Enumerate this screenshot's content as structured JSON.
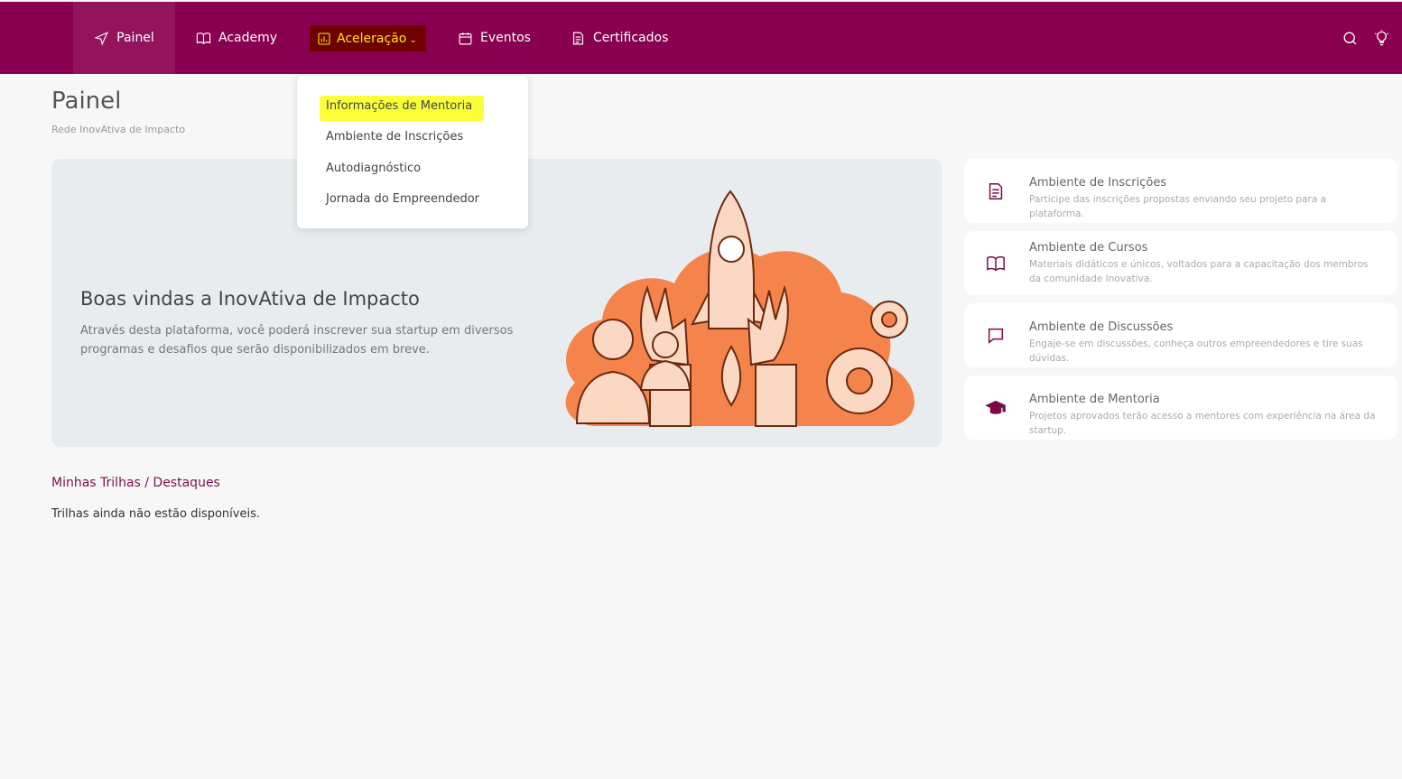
{
  "nav": {
    "items": [
      {
        "label": "Painel",
        "icon": "send-icon"
      },
      {
        "label": "Academy",
        "icon": "book-icon"
      },
      {
        "label": "Aceleração",
        "icon": "chart-icon",
        "active": true
      },
      {
        "label": "Eventos",
        "icon": "calendar-icon"
      },
      {
        "label": "Certificados",
        "icon": "document-icon"
      }
    ],
    "right_icons": [
      "search-icon",
      "lightbulb-icon"
    ]
  },
  "dropdown": {
    "items": [
      "Informações de Mentoria",
      "Ambiente de Inscrições",
      "Autodiagnóstico",
      "Jornada do Empreendedor"
    ],
    "highlighted_index": 0
  },
  "page": {
    "title": "Painel",
    "subtitle": "Rede InovAtiva de Impacto"
  },
  "hero": {
    "title": "Boas vindas a InovAtiva de Impacto",
    "text": "Através desta plataforma, você poderá inscrever sua startup em diversos programas e desafios que serão disponibilizados em breve."
  },
  "cards": [
    {
      "title": "Ambiente de Inscrições",
      "desc": "Participe das inscrições propostas enviando seu projeto para a plataforma.",
      "icon": "document-icon"
    },
    {
      "title": "Ambiente de Cursos",
      "desc": "Materiais didáticos e únicos, voltados para a capacitação dos membros da comunidade Inovativa.",
      "icon": "book-icon"
    },
    {
      "title": "Ambiente de Discussões",
      "desc": "Engaje-se em discussões, conheça outros empreendedores e tire suas dúvidas.",
      "icon": "chat-icon"
    },
    {
      "title": "Ambiente de Mentoria",
      "desc": "Projetos aprovados terão acesso a mentores com experiência na área da startup.",
      "icon": "graduation-cap-icon"
    }
  ],
  "trilhas": {
    "heading": "Minhas Trilhas / Destaques",
    "empty": "Trilhas ainda não estão disponíveis."
  },
  "colors": {
    "brand": "#8a0050",
    "highlight": "#faff3a",
    "illustration": "#f5844c"
  }
}
